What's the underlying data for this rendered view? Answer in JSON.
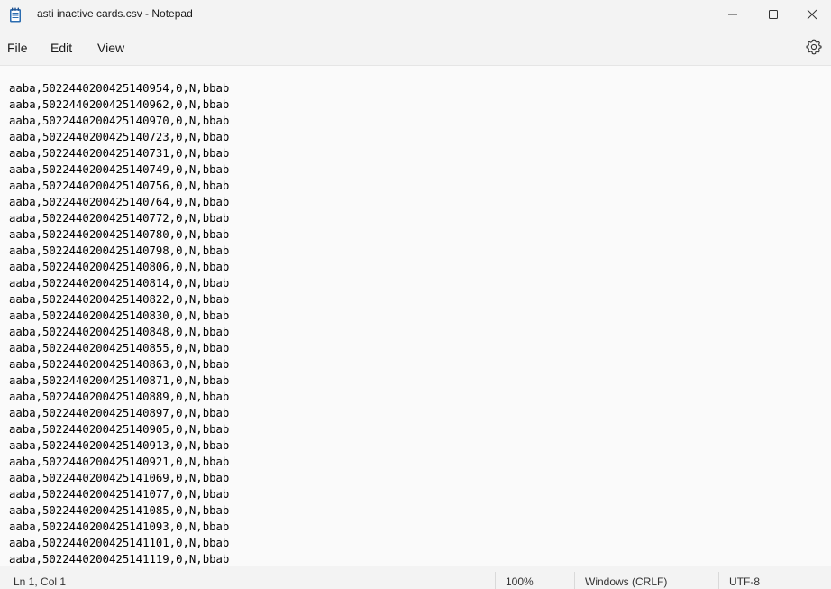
{
  "window": {
    "title": "asti inactive cards.csv - Notepad"
  },
  "menu": {
    "file": "File",
    "edit": "Edit",
    "view": "View"
  },
  "editor": {
    "lines": [
      "aaba,5022440200425140954,0,N,bbab",
      "aaba,5022440200425140962,0,N,bbab",
      "aaba,5022440200425140970,0,N,bbab",
      "aaba,5022440200425140723,0,N,bbab",
      "aaba,5022440200425140731,0,N,bbab",
      "aaba,5022440200425140749,0,N,bbab",
      "aaba,5022440200425140756,0,N,bbab",
      "aaba,5022440200425140764,0,N,bbab",
      "aaba,5022440200425140772,0,N,bbab",
      "aaba,5022440200425140780,0,N,bbab",
      "aaba,5022440200425140798,0,N,bbab",
      "aaba,5022440200425140806,0,N,bbab",
      "aaba,5022440200425140814,0,N,bbab",
      "aaba,5022440200425140822,0,N,bbab",
      "aaba,5022440200425140830,0,N,bbab",
      "aaba,5022440200425140848,0,N,bbab",
      "aaba,5022440200425140855,0,N,bbab",
      "aaba,5022440200425140863,0,N,bbab",
      "aaba,5022440200425140871,0,N,bbab",
      "aaba,5022440200425140889,0,N,bbab",
      "aaba,5022440200425140897,0,N,bbab",
      "aaba,5022440200425140905,0,N,bbab",
      "aaba,5022440200425140913,0,N,bbab",
      "aaba,5022440200425140921,0,N,bbab",
      "aaba,5022440200425141069,0,N,bbab",
      "aaba,5022440200425141077,0,N,bbab",
      "aaba,5022440200425141085,0,N,bbab",
      "aaba,5022440200425141093,0,N,bbab",
      "aaba,5022440200425141101,0,N,bbab",
      "aaba,5022440200425141119,0,N,bbab"
    ]
  },
  "status": {
    "position": "Ln 1, Col 1",
    "zoom": "100%",
    "line_ending": "Windows (CRLF)",
    "encoding": "UTF-8"
  },
  "icons": {
    "app": "notepad-icon",
    "minimize": "minimize-icon",
    "maximize": "maximize-icon",
    "close": "close-icon",
    "settings": "gear-icon"
  }
}
